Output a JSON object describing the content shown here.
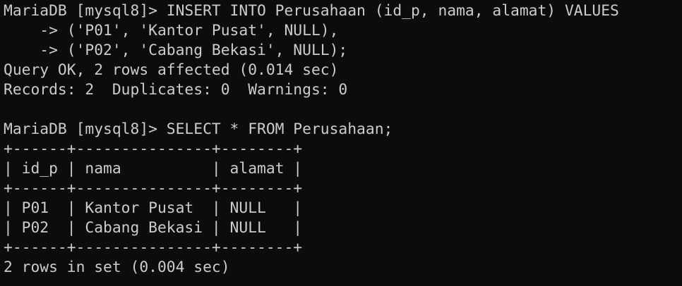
{
  "terminal": {
    "lines": [
      "MariaDB [mysql8]> INSERT INTO Perusahaan (id_p, nama, alamat) VALUES",
      "    -> ('P01', 'Kantor Pusat', NULL),",
      "    -> ('P02', 'Cabang Bekasi', NULL);",
      "Query OK, 2 rows affected (0.014 sec)",
      "Records: 2  Duplicates: 0  Warnings: 0",
      "",
      "MariaDB [mysql8]> SELECT * FROM Perusahaan;",
      "+------+---------------+--------+",
      "| id_p | nama          | alamat |",
      "+------+---------------+--------+",
      "| P01  | Kantor Pusat  | NULL   |",
      "| P02  | Cabang Bekasi | NULL   |",
      "+------+---------------+--------+",
      "2 rows in set (0.004 sec)"
    ]
  },
  "colors": {
    "background": "#0c0c0c",
    "text": "#cccccc"
  }
}
